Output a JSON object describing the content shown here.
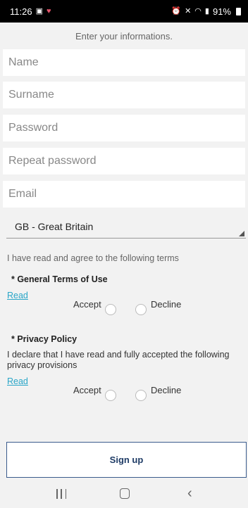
{
  "status_bar": {
    "time": "11:26",
    "battery": "91%"
  },
  "form": {
    "intro": "Enter your informations.",
    "name_placeholder": "Name",
    "surname_placeholder": "Surname",
    "password_placeholder": "Password",
    "repeat_password_placeholder": "Repeat password",
    "email_placeholder": "Email",
    "country_selected": "GB - Great Britain"
  },
  "terms": {
    "intro": "I have read and agree to the following terms",
    "general": {
      "title": "* General Terms of Use",
      "read_label": "Read",
      "accept_label": "Accept",
      "decline_label": "Decline"
    },
    "privacy": {
      "title": "* Privacy Policy",
      "description": "I declare that I have read and fully accepted the following privacy provisions",
      "read_label": "Read",
      "accept_label": "Accept",
      "decline_label": "Decline"
    }
  },
  "signup_label": "Sign up",
  "colors": {
    "link": "#2aa6c8",
    "button_border": "#3a5b8c",
    "background": "#f2f2f2"
  }
}
